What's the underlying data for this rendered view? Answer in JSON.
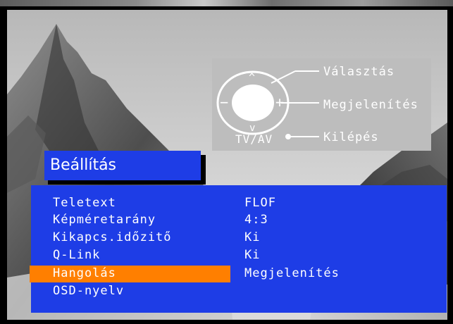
{
  "remote_legend": {
    "select_label": "Választás",
    "show_label": "Megjelenítés",
    "exit_label": "Kilépés",
    "tvav_label": "TV/AV",
    "up_symbol": "^",
    "down_symbol": "v",
    "minus_symbol": "−",
    "plus_symbol": "+"
  },
  "menu": {
    "title": "Beállítás",
    "items": [
      {
        "label": "Teletext",
        "value": "FLOF"
      },
      {
        "label": "Képméretarány",
        "value": "4:3"
      },
      {
        "label": "Kikapcs.időzitő",
        "value": "Ki"
      },
      {
        "label": "Q-Link",
        "value": "Ki"
      },
      {
        "label": "Hangolás",
        "value": "Megjelenítés",
        "selected": true
      },
      {
        "label": "OSD-nyelv",
        "value": ""
      }
    ]
  },
  "colors": {
    "panel_blue": "#1e3de6",
    "highlight_orange": "#ff7f00",
    "legend_gray": "#bdbdbd"
  }
}
